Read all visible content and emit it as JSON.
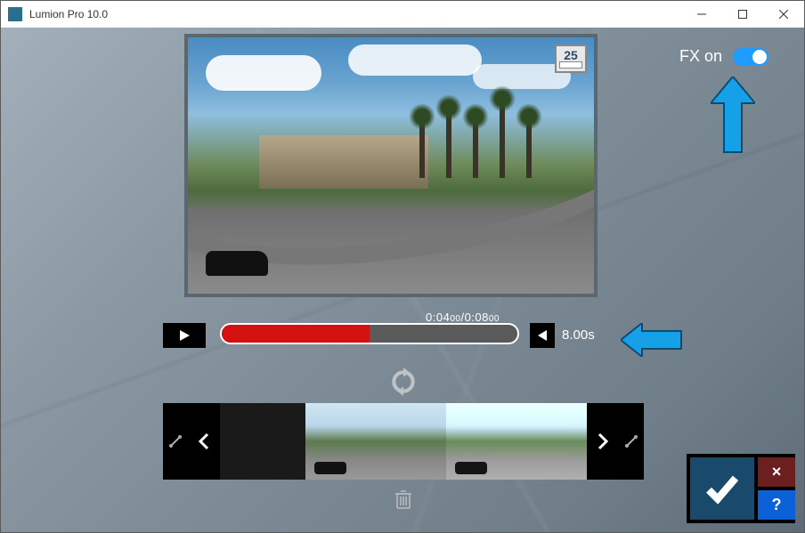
{
  "window": {
    "title": "Lumion Pro 10.0"
  },
  "fx": {
    "label": "FX on",
    "enabled": true
  },
  "preview": {
    "fps": "25"
  },
  "timeline": {
    "current": "0:04",
    "current_frac": "00",
    "total": "0:08",
    "total_frac": "00",
    "progress_pct": 50,
    "duration_label": "8.00s"
  },
  "icons": {
    "play": "play",
    "prev": "prev",
    "refresh": "refresh",
    "trash": "trash",
    "chevron_left": "chevron-left",
    "chevron_right": "chevron-right",
    "link": "link"
  },
  "confirm": {
    "ok": "✓",
    "cancel": "×",
    "help": "?"
  }
}
